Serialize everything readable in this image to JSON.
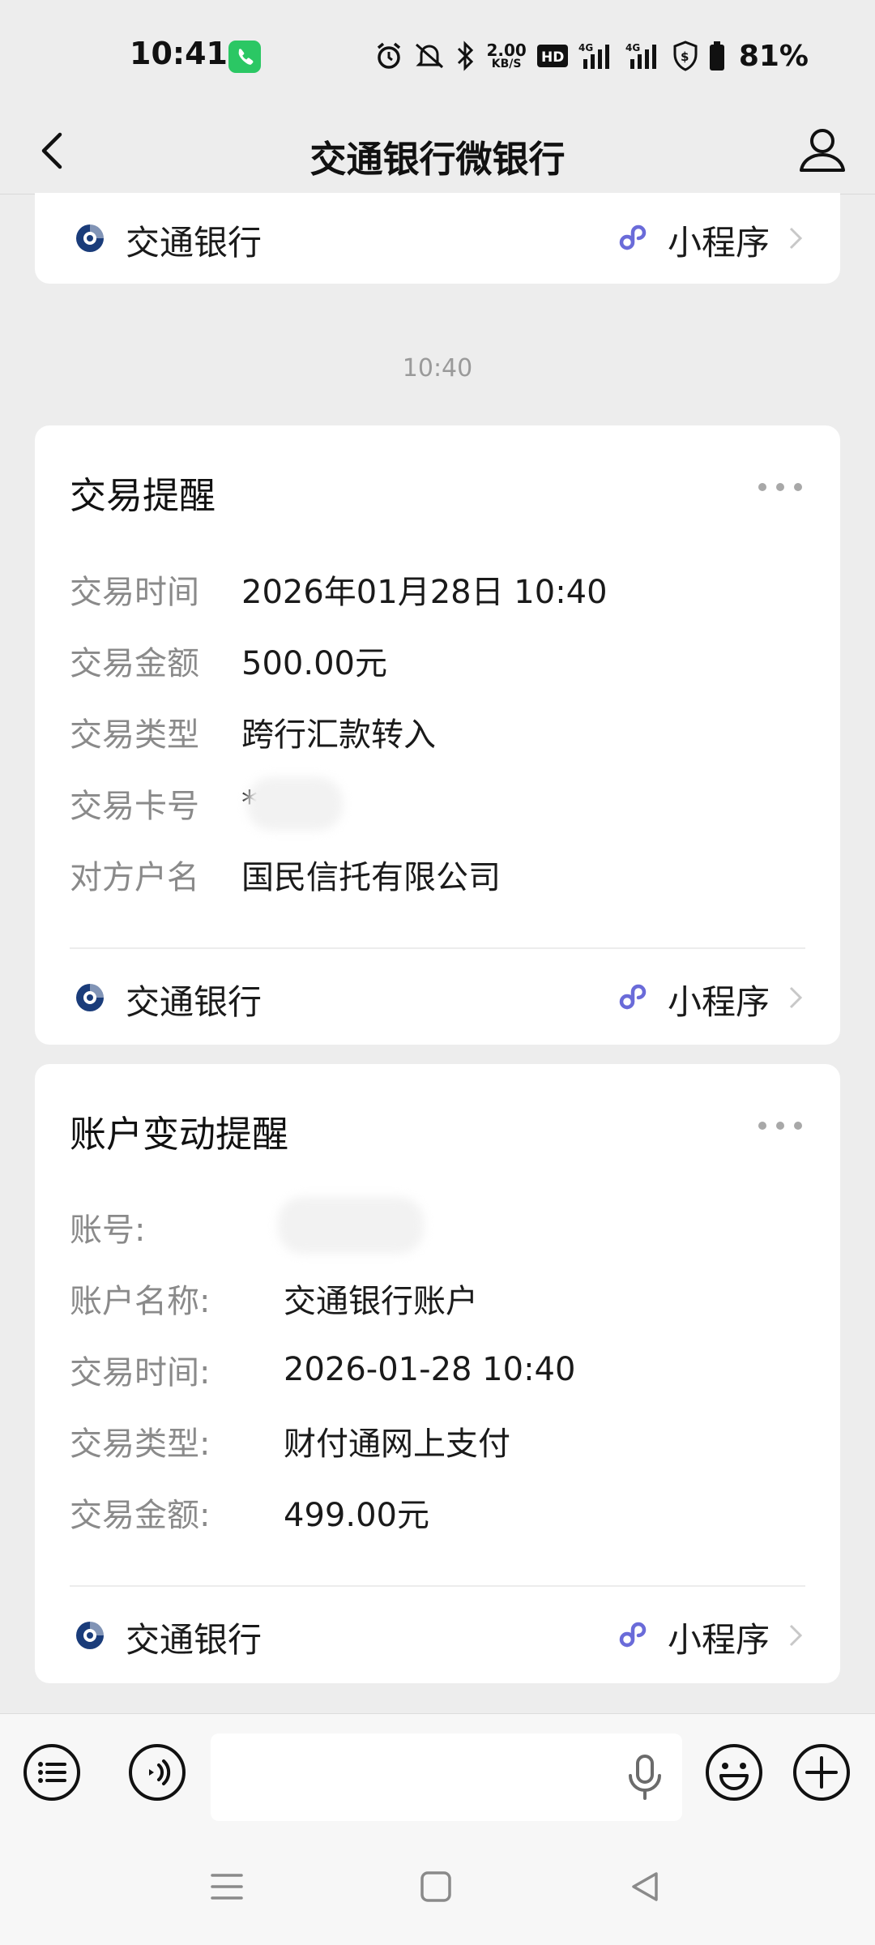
{
  "status_bar": {
    "time": "10:41",
    "net_speed_value": "2.00",
    "net_speed_unit": "KB/S",
    "hd_label": "HD",
    "network_label": "4G",
    "battery": "81%"
  },
  "header": {
    "title": "交通银行微银行"
  },
  "top_card": {
    "bank_name": "交通银行",
    "mini_program_label": "小程序"
  },
  "timestamp": "10:40",
  "transaction_card": {
    "title": "交易提醒",
    "rows": [
      {
        "label": "交易时间",
        "value": "2026年01月28日 10:40"
      },
      {
        "label": "交易金额",
        "value": "500.00元"
      },
      {
        "label": "交易类型",
        "value": "跨行汇款转入"
      },
      {
        "label": "交易卡号",
        "value": "*"
      },
      {
        "label": "对方户名",
        "value": "国民信托有限公司"
      }
    ],
    "bank_name": "交通银行",
    "mini_program_label": "小程序"
  },
  "account_card": {
    "title": "账户变动提醒",
    "rows": [
      {
        "label": "账号:",
        "value": ""
      },
      {
        "label": "账户名称:",
        "value": "交通银行账户"
      },
      {
        "label": "交易时间:",
        "value": "2026-01-28 10:40"
      },
      {
        "label": "交易类型:",
        "value": "财付通网上支付"
      },
      {
        "label": "交易金额:",
        "value": "499.00元"
      }
    ],
    "bank_name": "交通银行",
    "mini_program_label": "小程序"
  },
  "colors": {
    "background": "#ededed",
    "card": "#ffffff",
    "label_gray": "#8a8a8a",
    "bank_logo_blue": "#1a3c7a",
    "mini_program_purple": "#6a6bd9",
    "call_green": "#2bc764"
  },
  "icons": {
    "back": "chevron-left-icon",
    "profile": "person-icon",
    "more": "ellipsis-icon",
    "menu": "list-icon",
    "voice": "voice-icon",
    "mic": "microphone-icon",
    "emoji": "smile-icon",
    "add": "plus-icon"
  }
}
